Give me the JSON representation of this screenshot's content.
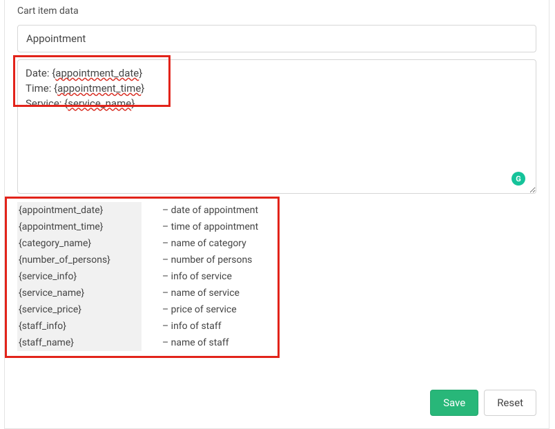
{
  "section": {
    "label": "Cart item data"
  },
  "title_input": {
    "value": "Appointment"
  },
  "textarea": {
    "lines": [
      {
        "prefix": "Date: {",
        "underlined": "appointment_date",
        "suffix": "}"
      },
      {
        "prefix": "Time: {",
        "underlined": "appointment_time",
        "suffix": "}"
      },
      {
        "prefix": "Service: {",
        "underlined": "service_name",
        "suffix": "}"
      }
    ],
    "raw": "Date: {appointment_date}\nTime: {appointment_time}\nService: {service_name}"
  },
  "grammarly": {
    "glyph": "G"
  },
  "shortcodes": [
    {
      "code": "{appointment_date}",
      "desc": "– date of appointment"
    },
    {
      "code": "{appointment_time}",
      "desc": "– time of appointment"
    },
    {
      "code": "{category_name}",
      "desc": "– name of category"
    },
    {
      "code": "{number_of_persons}",
      "desc": "– number of persons"
    },
    {
      "code": "{service_info}",
      "desc": "– info of service"
    },
    {
      "code": "{service_name}",
      "desc": "– name of service"
    },
    {
      "code": "{service_price}",
      "desc": "– price of service"
    },
    {
      "code": "{staff_info}",
      "desc": "– info of staff"
    },
    {
      "code": "{staff_name}",
      "desc": "– name of staff"
    }
  ],
  "buttons": {
    "save_label": "Save",
    "reset_label": "Reset"
  },
  "colors": {
    "highlight_border": "#e2231a",
    "save_bg": "#28b779"
  }
}
